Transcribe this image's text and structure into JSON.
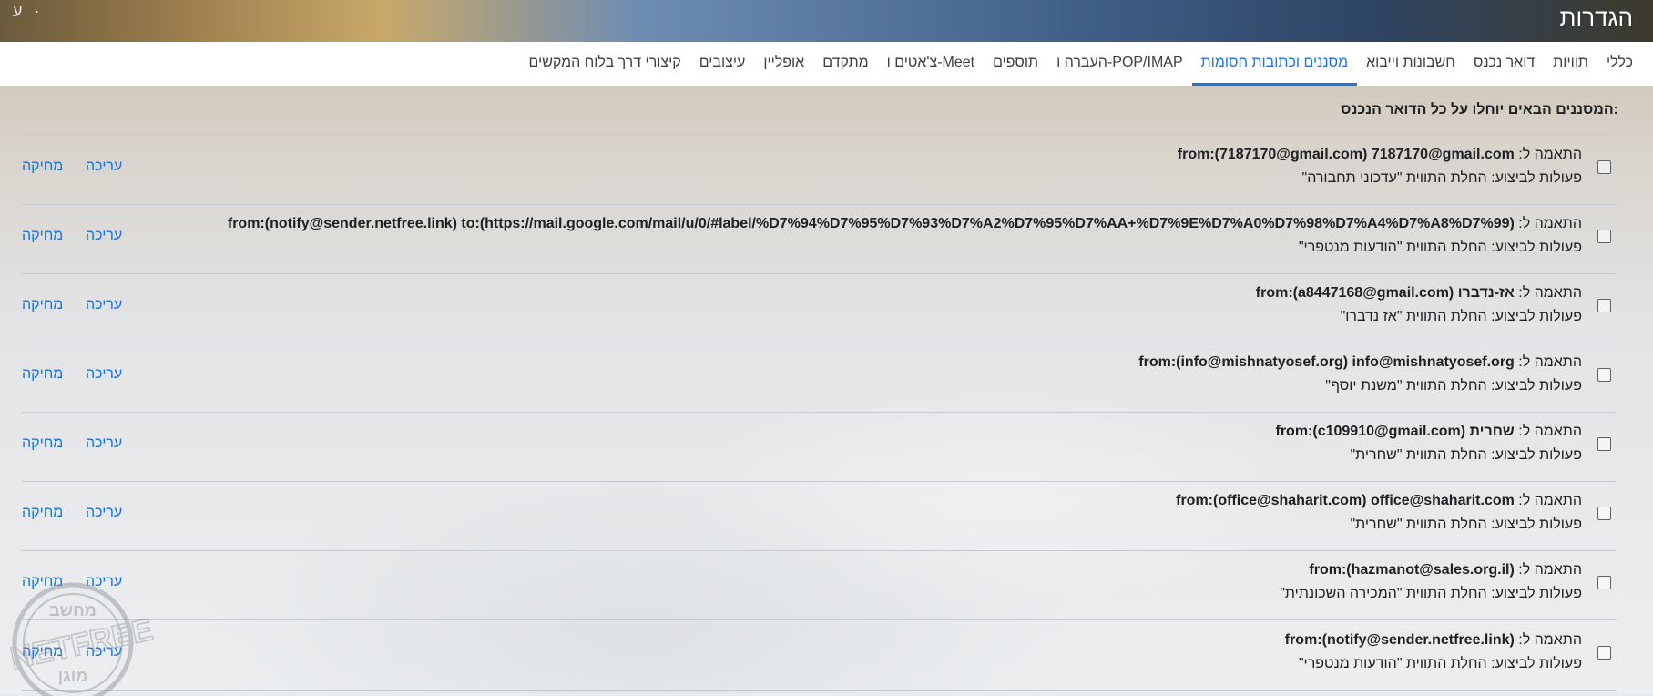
{
  "header": {
    "title": "הגדרות",
    "left_widget": "ע ·"
  },
  "tabs": [
    {
      "label": "כללי",
      "active": false
    },
    {
      "label": "תוויות",
      "active": false
    },
    {
      "label": "דואר נכנס",
      "active": false
    },
    {
      "label": "חשבונות וייבוא",
      "active": false
    },
    {
      "label": "מסננים וכתובות חסומות",
      "active": true
    },
    {
      "label": "העברה ו-POP/IMAP",
      "active": false
    },
    {
      "label": "תוספים",
      "active": false
    },
    {
      "label": "צ'אטים ו-Meet",
      "active": false
    },
    {
      "label": "מתקדם",
      "active": false
    },
    {
      "label": "אופליין",
      "active": false
    },
    {
      "label": "עיצובים",
      "active": false
    },
    {
      "label": "קיצורי דרך בלוח המקשים",
      "active": false
    }
  ],
  "main": {
    "heading": "המסננים הבאים יוחלו על כל הדואר הנכנס:",
    "match_prefix": "התאמה ל: ",
    "action_prefix": "פעולות לביצוע: ",
    "edit_label": "עריכה",
    "delete_label": "מחיקה",
    "filters": [
      {
        "match": "from:(7187170@gmail.com) 7187170@gmail.com",
        "action": "החלת התווית \"עדכוני תחבורה\""
      },
      {
        "match": "from:(notify@sender.netfree.link) to:(https://mail.google.com/mail/u/0/#label/%D7%94%D7%95%D7%93%D7%A2%D7%95%D7%AA+%D7%9E%D7%A0%D7%98%D7%A4%D7%A8%D7%99)",
        "action": "החלת התווית \"הודעות מנטפרי\""
      },
      {
        "match": "from:(a8447168@gmail.com) אז-נדברו",
        "action": "החלת התווית \"אז נדברו\""
      },
      {
        "match": "from:(info@mishnatyosef.org) info@mishnatyosef.org",
        "action": "החלת התווית \"משנת יוסף\""
      },
      {
        "match": "from:(c109910@gmail.com) שחרית",
        "action": "החלת התווית \"שחרית\""
      },
      {
        "match": "from:(office@shaharit.com) office@shaharit.com",
        "action": "החלת התווית \"שחרית\""
      },
      {
        "match": "from:(hazmanot@sales.org.il)",
        "action": "החלת התווית \"המכירה השכונתית\""
      },
      {
        "match": "from:(notify@sender.netfree.link)",
        "action": "החלת התווית \"הודעות מנטפרי\""
      }
    ]
  },
  "watermark": {
    "text_top": "מחשב",
    "text_main": "NETFREE",
    "text_bottom": "מוגן"
  }
}
